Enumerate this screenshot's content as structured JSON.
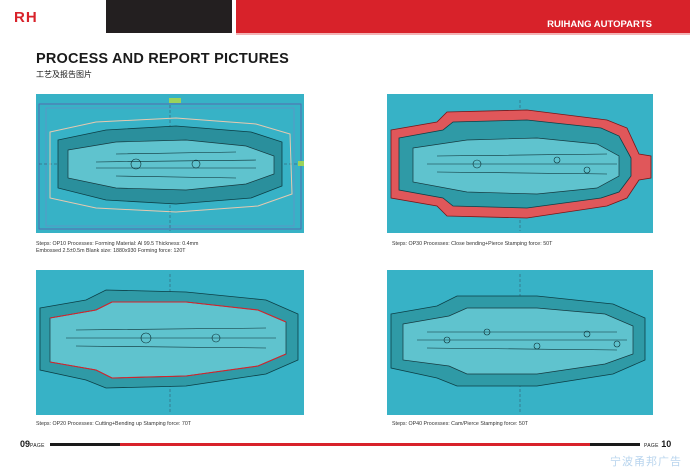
{
  "header": {
    "logo": "RH",
    "brand_strong": "RUIHANG",
    "brand_rest": "AUTOPARTS",
    "colors": {
      "red": "#d8222a",
      "black": "#231f20",
      "panel_bg": "#37b2c6"
    }
  },
  "title": "PROCESS AND REPORT PICTURES",
  "subtitle": "工艺及报告图片",
  "panels": [
    {
      "caption_lines": [
        "Steps: OP10   Processes: Forming   Material: Al 99.5   Thickness: 0.4mm",
        "Embossed 2.5±0.5m   Blank size: 1880x930   Forming force: 120T"
      ]
    },
    {
      "caption_lines": [
        "Steps: OP30   Processes: Close bending+Pierce   Stamping force: 50T"
      ]
    },
    {
      "caption_lines": [
        "Steps: OP20   Processes: Cutting+Bending up   Stamping force: 70T"
      ]
    },
    {
      "caption_lines": [
        "Steps: OP40   Processes: Cam/Pierce   Stamping force: 50T"
      ]
    }
  ],
  "footer": {
    "left_num": "09",
    "left_word": "PAGE",
    "right_word": "PAGE",
    "right_num": "10",
    "watermark": "宁波甬邦广告"
  }
}
